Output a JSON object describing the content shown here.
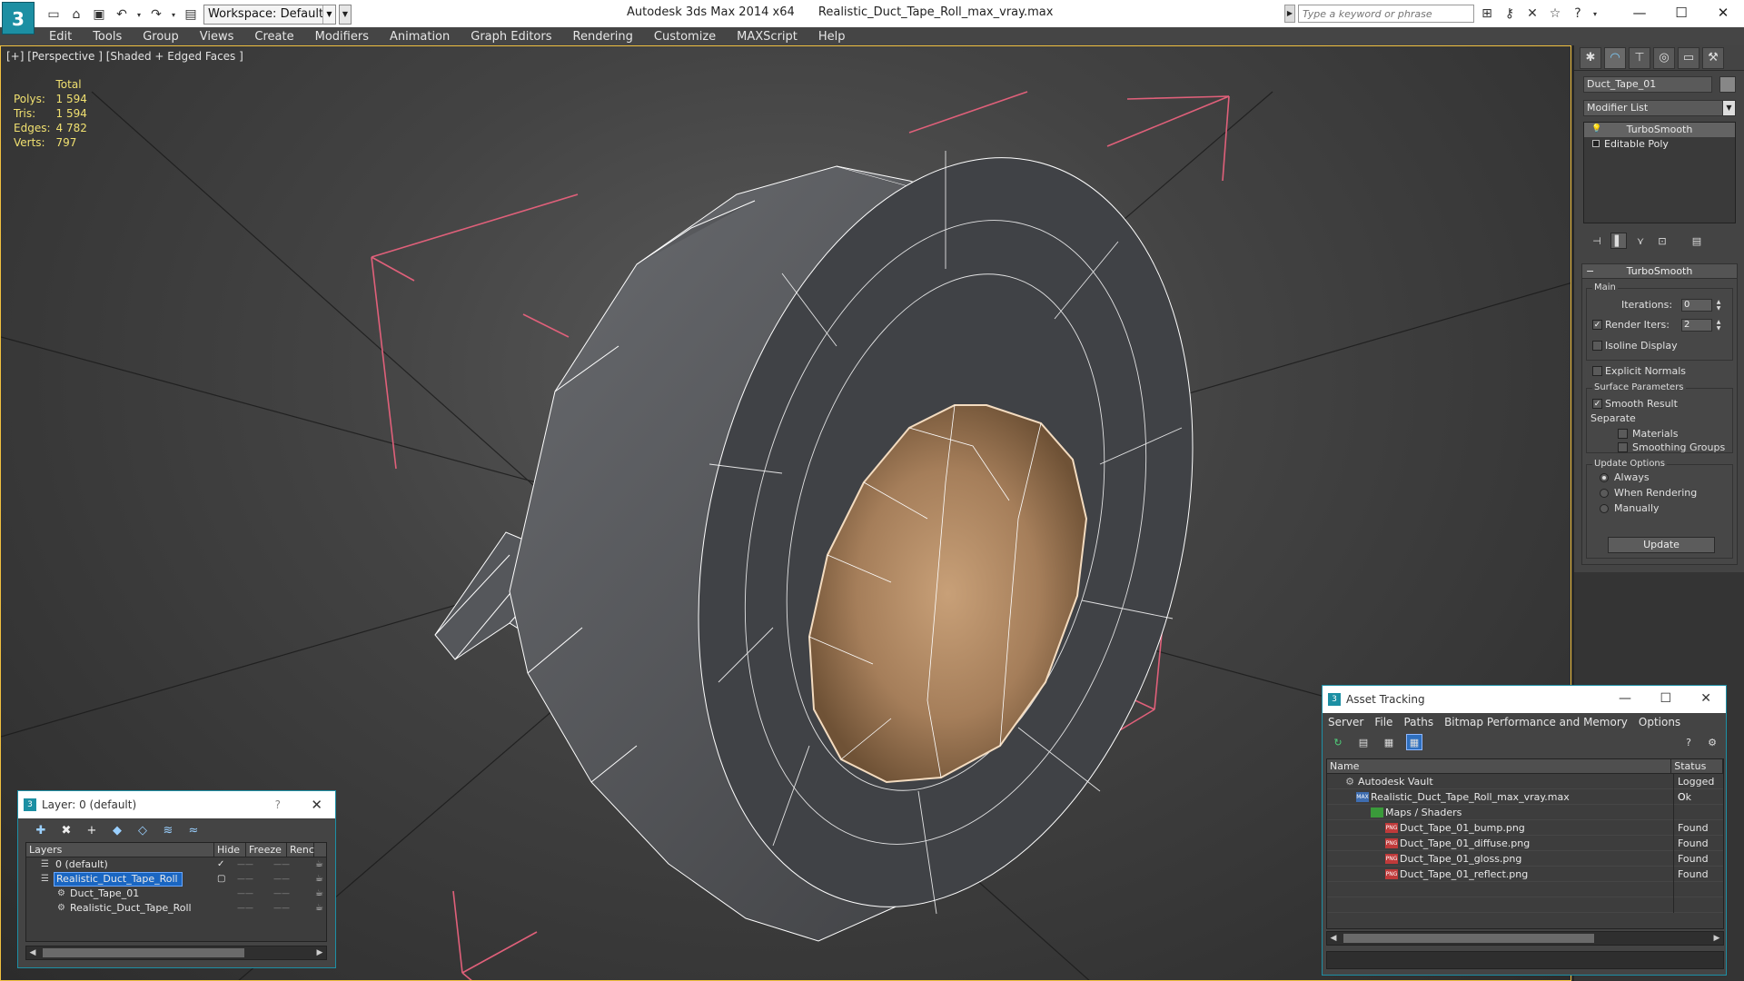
{
  "app": {
    "logo": "3",
    "title_app": "Autodesk 3ds Max  2014 x64",
    "title_file": "Realistic_Duct_Tape_Roll_max_vray.max",
    "workspace": "Workspace: Default",
    "search_placeholder": "Type a keyword or phrase"
  },
  "menu": [
    "Edit",
    "Tools",
    "Group",
    "Views",
    "Create",
    "Modifiers",
    "Animation",
    "Graph Editors",
    "Rendering",
    "Customize",
    "MAXScript",
    "Help"
  ],
  "viewport": {
    "label": "[+] [Perspective ] [Shaded + Edged Faces ]",
    "stats": {
      "total_label": "Total",
      "rows": [
        {
          "label": "Polys:",
          "value": "1 594"
        },
        {
          "label": "Tris:",
          "value": "1 594"
        },
        {
          "label": "Edges:",
          "value": "4 782"
        },
        {
          "label": "Verts:",
          "value": "797"
        }
      ]
    }
  },
  "command_panel": {
    "object_name": "Duct_Tape_01",
    "modifier_list": "Modifier List",
    "stack": [
      "TurboSmooth",
      "Editable Poly"
    ],
    "rollout_title": "TurboSmooth",
    "main_group": "Main",
    "iterations_label": "Iterations:",
    "iterations_value": "0",
    "render_iters_label": "Render Iters:",
    "render_iters_value": "2",
    "isoline_label": "Isoline Display",
    "explicit_label": "Explicit Normals",
    "surface_group": "Surface Parameters",
    "smooth_result_label": "Smooth Result",
    "separate_label": "Separate",
    "materials_label": "Materials",
    "smoothing_groups_label": "Smoothing Groups",
    "update_group": "Update Options",
    "always_label": "Always",
    "when_rendering_label": "When Rendering",
    "manually_label": "Manually",
    "update_button": "Update"
  },
  "layer_window": {
    "title": "Layer: 0 (default)",
    "help": "?",
    "columns": [
      "Layers",
      "Hide",
      "Freeze",
      "Renc"
    ],
    "rows": [
      {
        "name": "0 (default)",
        "indent": 1,
        "check": "✓"
      },
      {
        "name": "Realistic_Duct_Tape_Roll",
        "indent": 1,
        "check": "▢",
        "selected": true
      },
      {
        "name": "Duct_Tape_01",
        "indent": 2,
        "check": ""
      },
      {
        "name": "Realistic_Duct_Tape_Roll",
        "indent": 2,
        "check": ""
      }
    ]
  },
  "asset_tracking": {
    "title": "Asset Tracking",
    "menu": [
      "Server",
      "File",
      "Paths",
      "Bitmap Performance and Memory",
      "Options"
    ],
    "columns": [
      "Name",
      "Status"
    ],
    "rows": [
      {
        "name": "Autodesk Vault",
        "status": "Logged O",
        "indent": 0,
        "icon": "vault"
      },
      {
        "name": "Realistic_Duct_Tape_Roll_max_vray.max",
        "status": "Ok",
        "indent": 1,
        "icon": "max"
      },
      {
        "name": "Maps / Shaders",
        "status": "",
        "indent": 2,
        "icon": "folder"
      },
      {
        "name": "Duct_Tape_01_bump.png",
        "status": "Found",
        "indent": 3,
        "icon": "png"
      },
      {
        "name": "Duct_Tape_01_diffuse.png",
        "status": "Found",
        "indent": 3,
        "icon": "png"
      },
      {
        "name": "Duct_Tape_01_gloss.png",
        "status": "Found",
        "indent": 3,
        "icon": "png"
      },
      {
        "name": "Duct_Tape_01_reflect.png",
        "status": "Found",
        "indent": 3,
        "icon": "png"
      }
    ],
    "icon_labels": {
      "max": "MAX",
      "png": "PNG"
    }
  },
  "colors": {
    "accent": "#1c8fa3",
    "selection": "#1a66c2",
    "bbox_lines": "#e0607a",
    "viewport_border": "#f0c040"
  }
}
